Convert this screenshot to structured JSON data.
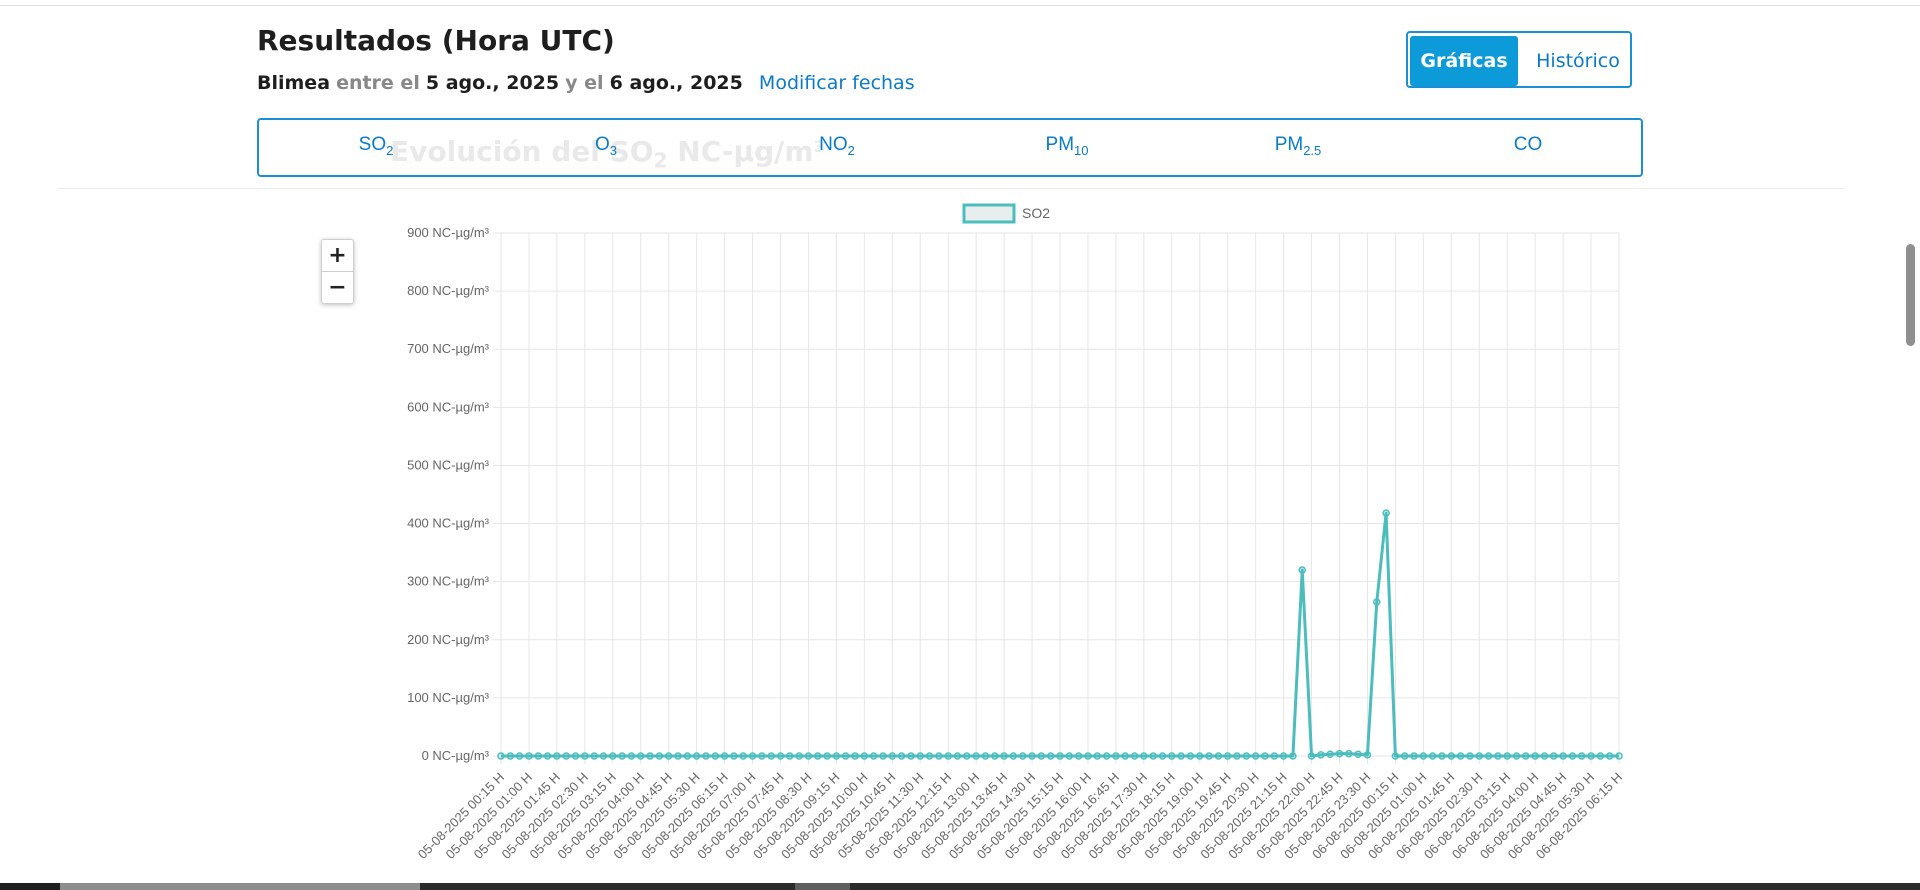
{
  "header": {
    "title": "Resultados (Hora UTC)",
    "station": "Blimea",
    "between_word": "entre el",
    "start_date": "5 ago., 2025",
    "and_word": "y el",
    "end_date": "6 ago., 2025",
    "modify_link": "Modificar fechas"
  },
  "view_toggle": {
    "graficas": "Gráficas",
    "historico": "Histórico",
    "active": "graficas"
  },
  "pollutant_tabs": [
    {
      "base": "SO",
      "sub": "2"
    },
    {
      "base": "O",
      "sub": "3"
    },
    {
      "base": "NO",
      "sub": "2"
    },
    {
      "base": "PM",
      "sub": "10"
    },
    {
      "base": "PM",
      "sub": "2.5"
    },
    {
      "base": "CO",
      "sub": ""
    }
  ],
  "chart_heading": {
    "text_before": "Evolución del SO",
    "sub": "2",
    "text_after": " NC-μg/m³"
  },
  "zoom": {
    "in": "+",
    "out": "−"
  },
  "colors": {
    "accent": "#0d9ad8",
    "link": "#0a7bc8",
    "series": "#4bbdbd",
    "legend_fill": "#e8eded"
  },
  "chart_data": {
    "type": "line",
    "title": "Evolución del SO2 NC-μg/m³",
    "unit_suffix": " NC-µg/m³",
    "legend": {
      "position": "top-center",
      "entries": [
        "SO2"
      ]
    },
    "grid": true,
    "ylim": [
      0,
      900
    ],
    "yticks": [
      0,
      100,
      200,
      300,
      400,
      500,
      600,
      700,
      800,
      900
    ],
    "x_start": "2025-08-05 00:15",
    "x_step_minutes": 15,
    "x_label_every": 3,
    "series": [
      {
        "name": "SO2",
        "color": "#4bbdbd",
        "values": [
          0,
          0,
          0,
          0,
          0,
          0,
          0,
          0,
          0,
          0,
          0,
          0,
          0,
          0,
          0,
          0,
          0,
          0,
          0,
          0,
          0,
          0,
          0,
          0,
          0,
          0,
          0,
          0,
          0,
          0,
          0,
          0,
          0,
          0,
          0,
          0,
          0,
          0,
          0,
          0,
          0,
          0,
          0,
          0,
          0,
          0,
          0,
          0,
          0,
          0,
          0,
          0,
          0,
          0,
          0,
          0,
          0,
          0,
          0,
          0,
          0,
          0,
          0,
          0,
          0,
          0,
          0,
          0,
          0,
          0,
          0,
          0,
          0,
          0,
          0,
          0,
          0,
          0,
          0,
          0,
          0,
          0,
          0,
          0,
          0,
          0,
          320,
          0,
          2,
          3,
          4,
          4,
          3,
          2,
          265,
          418,
          0,
          0,
          0,
          0,
          0,
          0,
          0,
          0,
          0,
          0,
          0,
          0,
          0,
          0,
          0,
          0,
          0,
          0,
          0,
          0,
          0,
          0,
          0,
          0,
          0
        ]
      }
    ]
  }
}
